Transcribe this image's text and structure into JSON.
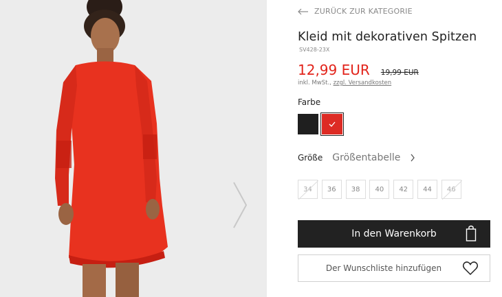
{
  "navigation": {
    "back_label": "ZURÜCK ZUR KATEGORIE"
  },
  "product": {
    "title": "Kleid mit dekorativen Spitzen",
    "sku": "SV428-23X",
    "price": "12,99 EUR",
    "old_price": "19,99 EUR",
    "tax_prefix": "inkl. MwSt., ",
    "shipping_link": "zzgl. Versandkosten"
  },
  "color": {
    "label": "Farbe",
    "swatches": [
      {
        "name": "black",
        "hex": "#1f1f1f",
        "selected": false
      },
      {
        "name": "red",
        "hex": "#dd2b24",
        "selected": true
      }
    ]
  },
  "size": {
    "label": "Größe",
    "table_link": "Größentabelle",
    "options": [
      {
        "value": "34",
        "available": false
      },
      {
        "value": "36",
        "available": true
      },
      {
        "value": "38",
        "available": true
      },
      {
        "value": "40",
        "available": true
      },
      {
        "value": "42",
        "available": true
      },
      {
        "value": "44",
        "available": true
      },
      {
        "value": "46",
        "available": false
      }
    ]
  },
  "actions": {
    "cart_label": "In den Warenkorb",
    "wishlist_label": "Der Wunschliste hinzufügen"
  },
  "icons": {
    "back": "arrow-left-icon",
    "next": "chevron-right-icon",
    "cart": "shopping-bag-icon",
    "wishlist": "heart-icon",
    "selected": "checkmark-icon"
  },
  "colors": {
    "accent_price": "#e2231a",
    "button_dark": "#222222"
  }
}
